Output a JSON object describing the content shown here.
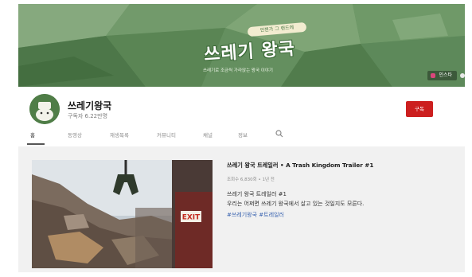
{
  "banner": {
    "logo_subtitle": "언젠가 그 랜드에",
    "logo_title": "쓰레기 왕국",
    "tagline": "쓰레기로 조금씩 가라앉는 왕국 이야기",
    "link_label": "인스타"
  },
  "channel": {
    "name": "쓰레기왕국",
    "subscribers": "구독자 6.22만명",
    "subscribe_label": "구독"
  },
  "tabs": [
    {
      "label": "홈"
    },
    {
      "label": "동영상"
    },
    {
      "label": "재생목록"
    },
    {
      "label": "커뮤니티"
    },
    {
      "label": "채널"
    },
    {
      "label": "정보"
    }
  ],
  "video": {
    "title": "쓰레기 왕국 트레일러 • A Trash Kingdom Trailer #1",
    "meta": "조회수 6,830회 • 1년 전",
    "description_line1": "쓰레기 왕국 트레일러 #1",
    "description_line2": "우리는 어쩌면 쓰레기 왕국에서 살고 있는 것일지도 모른다.",
    "hashtags": "#쓰레기왕국 #트레일러",
    "exit_sign": "EXIT"
  },
  "colors": {
    "banner_green": "#5f8a5a",
    "subscribe_red": "#cc1f1f",
    "hashtag_blue": "#3a64b0"
  }
}
